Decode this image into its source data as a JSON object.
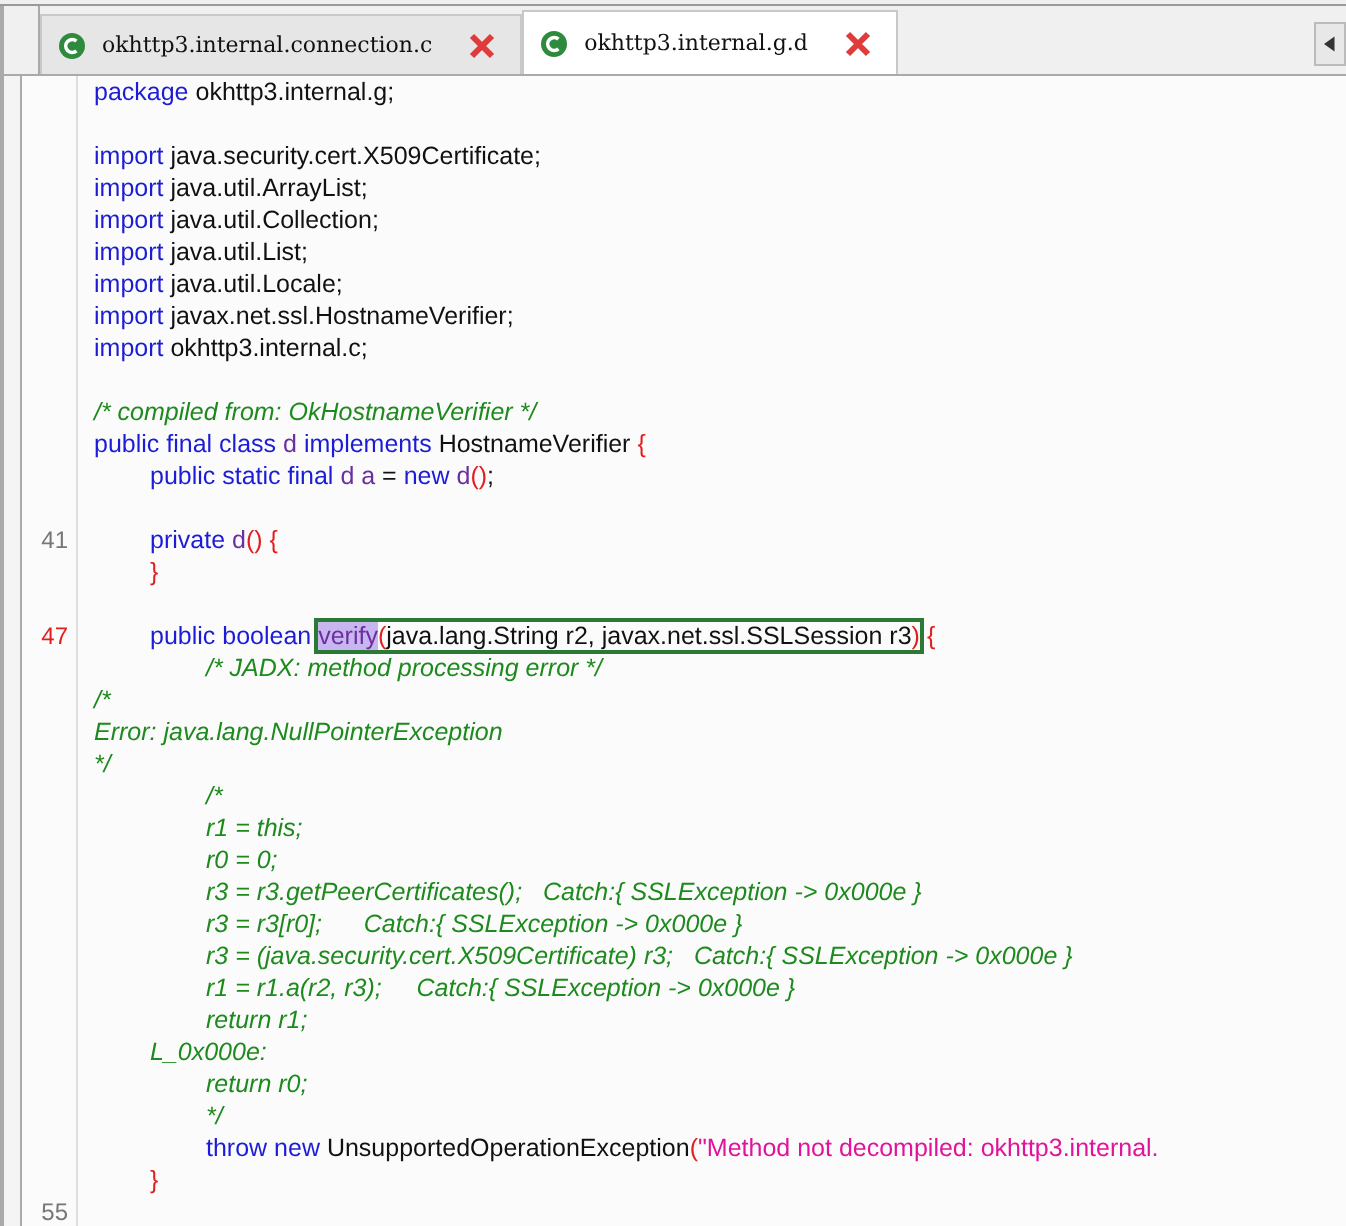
{
  "tabs": [
    {
      "label": "okhttp3.internal.connection.c",
      "selected": false
    },
    {
      "label": "okhttp3.internal.g.d",
      "selected": true
    }
  ],
  "blocks": [
    {
      "lines": [
        {
          "tokens": [
            {
              "kind": "keyword",
              "text": "package"
            },
            {
              "kind": "plain",
              "text": " okhttp3.internal.g;"
            }
          ]
        }
      ]
    },
    {
      "lines": [
        {
          "tokens": [
            {
              "kind": "keyword",
              "text": "import"
            },
            {
              "kind": "plain",
              "text": " java.security.cert.X509Certificate;"
            }
          ]
        },
        {
          "tokens": [
            {
              "kind": "keyword",
              "text": "import"
            },
            {
              "kind": "plain",
              "text": " java.util.ArrayList;"
            }
          ]
        },
        {
          "tokens": [
            {
              "kind": "keyword",
              "text": "import"
            },
            {
              "kind": "plain",
              "text": " java.util.Collection;"
            }
          ]
        },
        {
          "tokens": [
            {
              "kind": "keyword",
              "text": "import"
            },
            {
              "kind": "plain",
              "text": " java.util.List;"
            }
          ]
        },
        {
          "tokens": [
            {
              "kind": "keyword",
              "text": "import"
            },
            {
              "kind": "plain",
              "text": " java.util.Locale;"
            }
          ]
        },
        {
          "tokens": [
            {
              "kind": "keyword",
              "text": "import"
            },
            {
              "kind": "plain",
              "text": " javax.net.ssl.HostnameVerifier;"
            }
          ]
        },
        {
          "tokens": [
            {
              "kind": "keyword",
              "text": "import"
            },
            {
              "kind": "plain",
              "text": " okhttp3.internal.c;"
            }
          ]
        }
      ]
    },
    {
      "lines": [
        {
          "tokens": [
            {
              "kind": "comment",
              "text": "/* compiled from: OkHostnameVerifier */"
            }
          ]
        },
        {
          "tokens": [
            {
              "kind": "keyword",
              "text": "public final class "
            },
            {
              "kind": "name",
              "text": "d "
            },
            {
              "kind": "keyword",
              "text": "implements"
            },
            {
              "kind": "plain",
              "text": " HostnameVerifier "
            },
            {
              "kind": "punct",
              "text": "{"
            }
          ]
        },
        {
          "tokens": [
            {
              "kind": "keyword",
              "text": "\tpublic static final "
            },
            {
              "kind": "name",
              "text": "d a"
            },
            {
              "kind": "plain",
              "text": " = "
            },
            {
              "kind": "keyword",
              "text": "new "
            },
            {
              "kind": "name",
              "text": "d"
            },
            {
              "kind": "punct",
              "text": "()"
            },
            {
              "kind": "plain",
              "text": ";"
            }
          ]
        }
      ]
    },
    {
      "lines": [
        {
          "number": "41",
          "marked": false,
          "tokens": [
            {
              "kind": "keyword",
              "text": "\tprivate "
            },
            {
              "kind": "name",
              "text": "d"
            },
            {
              "kind": "punct",
              "text": "() {"
            }
          ]
        },
        {
          "tokens": [
            {
              "kind": "punct",
              "text": "\t}"
            }
          ]
        }
      ]
    },
    {
      "lines": [
        {
          "number": "47",
          "marked": true,
          "tokens": [
            {
              "kind": "keyword",
              "text": "\tpublic boolean "
            },
            {
              "kind": "group",
              "outlined": true,
              "tokens": [
                {
                  "kind": "name",
                  "text": "verify",
                  "selected": true
                },
                {
                  "kind": "punct",
                  "text": "("
                },
                {
                  "kind": "plain",
                  "text": "java.lang.String r2, javax.net.ssl.SSLSession r3"
                },
                {
                  "kind": "punct",
                  "text": ")"
                }
              ]
            },
            {
              "kind": "punct",
              "text": " {"
            }
          ]
        },
        {
          "tokens": [
            {
              "kind": "comment",
              "text": "\t\t/* JADX: method processing error */"
            }
          ]
        },
        {
          "tokens": [
            {
              "kind": "comment",
              "text": "/*"
            }
          ]
        },
        {
          "tokens": [
            {
              "kind": "comment",
              "text": "Error: java.lang.NullPointerException"
            }
          ]
        },
        {
          "tokens": [
            {
              "kind": "comment",
              "text": "*/"
            }
          ]
        },
        {
          "tokens": [
            {
              "kind": "comment",
              "text": "\t\t/*"
            }
          ]
        },
        {
          "tokens": [
            {
              "kind": "comment",
              "text": "\t\tr1 = this;"
            }
          ]
        },
        {
          "tokens": [
            {
              "kind": "comment",
              "text": "\t\tr0 = 0;"
            }
          ]
        },
        {
          "tokens": [
            {
              "kind": "comment",
              "text": "\t\tr3 = r3.getPeerCertificates();   Catch:{ SSLException -> 0x000e }"
            }
          ]
        },
        {
          "tokens": [
            {
              "kind": "comment",
              "text": "\t\tr3 = r3[r0];      Catch:{ SSLException -> 0x000e }"
            }
          ]
        },
        {
          "tokens": [
            {
              "kind": "comment",
              "text": "\t\tr3 = (java.security.cert.X509Certificate) r3;   Catch:{ SSLException -> 0x000e }"
            }
          ]
        },
        {
          "tokens": [
            {
              "kind": "comment",
              "text": "\t\tr1 = r1.a(r2, r3);     Catch:{ SSLException -> 0x000e }"
            }
          ]
        },
        {
          "tokens": [
            {
              "kind": "comment",
              "text": "\t\treturn r1;"
            }
          ]
        },
        {
          "tokens": [
            {
              "kind": "comment",
              "text": "\tL_0x000e:"
            }
          ]
        },
        {
          "tokens": [
            {
              "kind": "comment",
              "text": "\t\treturn r0;"
            }
          ]
        },
        {
          "tokens": [
            {
              "kind": "comment",
              "text": "\t\t*/"
            }
          ]
        },
        {
          "tokens": [
            {
              "kind": "keyword",
              "text": "\t\tthrow new"
            },
            {
              "kind": "plain",
              "text": " UnsupportedOperationException"
            },
            {
              "kind": "punct",
              "text": "("
            },
            {
              "kind": "string",
              "text": "\"Method not decompiled: okhttp3.internal."
            }
          ]
        },
        {
          "tokens": [
            {
              "kind": "punct",
              "text": "\t}"
            }
          ]
        },
        {
          "number": "55",
          "marked": false
        }
      ]
    }
  ]
}
